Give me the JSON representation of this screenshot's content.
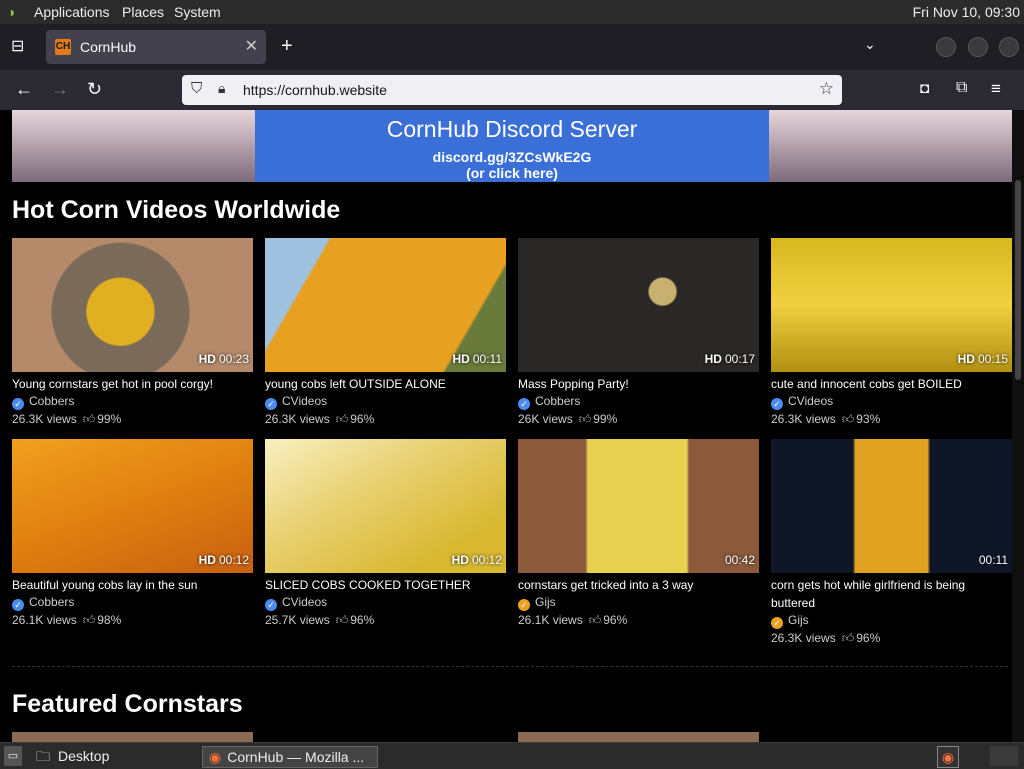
{
  "panel": {
    "applications": "Applications",
    "places": "Places",
    "system": "System",
    "clock": "Fri Nov 10, 09:30"
  },
  "browser": {
    "tab_title": "CornHub",
    "tab_favicon": "CH",
    "url": "https://cornhub.website"
  },
  "banner": {
    "line1": "CornHub Discord Server",
    "line2": "discord.gg/3ZCsWkE2G",
    "line3": "(or click here)"
  },
  "sections": {
    "hot": "Hot Corn Videos Worldwide",
    "featured": "Featured Cornstars"
  },
  "videos": [
    {
      "title": "Young cornstars get hot in pool corgy!",
      "channel": "Cobbers",
      "verified": "blue",
      "views": "26.3K views",
      "rating": "99%",
      "hd": "HD",
      "duration": "00:23"
    },
    {
      "title": "young cobs left OUTSIDE ALONE",
      "channel": "CVideos",
      "verified": "blue",
      "views": "26.3K views",
      "rating": "96%",
      "hd": "HD",
      "duration": "00:11"
    },
    {
      "title": "Mass Popping Party!",
      "channel": "Cobbers",
      "verified": "blue",
      "views": "26K views",
      "rating": "99%",
      "hd": "HD",
      "duration": "00:17"
    },
    {
      "title": "cute and innocent cobs get BOILED",
      "channel": "CVideos",
      "verified": "blue",
      "views": "26.3K views",
      "rating": "93%",
      "hd": "HD",
      "duration": "00:15"
    },
    {
      "title": "Beautiful young cobs lay in the sun",
      "channel": "Cobbers",
      "verified": "blue",
      "views": "26.1K views",
      "rating": "98%",
      "hd": "HD",
      "duration": "00:12"
    },
    {
      "title": "SLICED COBS COOKED TOGETHER",
      "channel": "CVideos",
      "verified": "blue",
      "views": "25.7K views",
      "rating": "96%",
      "hd": "HD",
      "duration": "00:12"
    },
    {
      "title": "cornstars get tricked into a 3 way",
      "channel": "Gijs",
      "verified": "orange",
      "views": "26.1K views",
      "rating": "96%",
      "hd": "",
      "duration": "00:42"
    },
    {
      "title": "corn gets hot while girlfriend is being buttered",
      "channel": "Gijs",
      "verified": "orange",
      "views": "26.3K views",
      "rating": "96%",
      "hd": "",
      "duration": "00:11"
    }
  ],
  "taskbar": {
    "desktop": "Desktop",
    "window": "CornHub — Mozilla ..."
  },
  "colors": {
    "verified_blue": "#4a8cf0",
    "verified_orange": "#f0a020",
    "page_bg": "#000000"
  }
}
